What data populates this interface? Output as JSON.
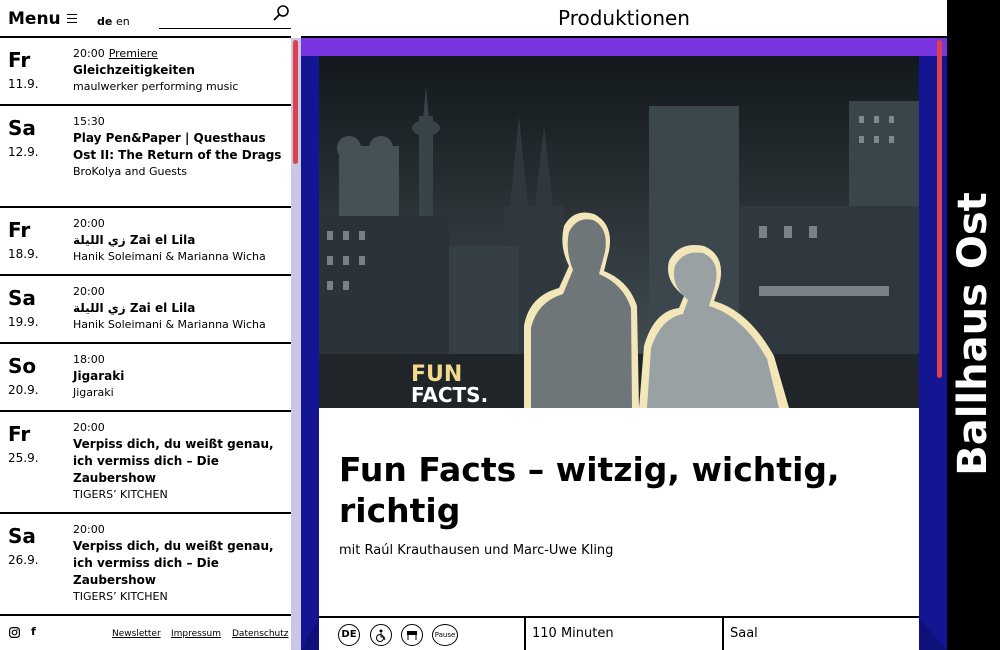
{
  "nav": {
    "menu_label": "Menu",
    "lang_de": "de",
    "lang_en": "en"
  },
  "header": {
    "title": "Produktionen"
  },
  "brand": {
    "name": "Ballhaus Ost"
  },
  "events": [
    {
      "day": "Fr",
      "date": "11.9.",
      "time": "20:00",
      "badge": "Premiere",
      "title": "Gleichzeitigkeiten",
      "subtitle": "maulwerker performing music"
    },
    {
      "day": "Sa",
      "date": "12.9.",
      "time": "15:30",
      "badge": "",
      "title": "Play Pen&Paper | Questhaus Ost II: The Return of the Drags",
      "subtitle": "BroKolya and Guests"
    },
    {
      "day": "Fr",
      "date": "18.9.",
      "time": "20:00",
      "badge": "",
      "title": "زي الليلة Zai el Lila",
      "subtitle": "Hanik Soleimani & Marianna Wicha"
    },
    {
      "day": "Sa",
      "date": "19.9.",
      "time": "20:00",
      "badge": "",
      "title": "زي الليلة Zai el Lila",
      "subtitle": "Hanik Soleimani & Marianna Wicha"
    },
    {
      "day": "So",
      "date": "20.9.",
      "time": "18:00",
      "badge": "",
      "title": "Jigaraki",
      "subtitle": "Jigaraki"
    },
    {
      "day": "Fr",
      "date": "25.9.",
      "time": "20:00",
      "badge": "",
      "title": "Verpiss dich, du weißt genau, ich vermiss dich – Die Zaubershow",
      "subtitle": "TIGERS’ KITCHEN"
    },
    {
      "day": "Sa",
      "date": "26.9.",
      "time": "20:00",
      "badge": "",
      "title": "Verpiss dich, du weißt genau, ich vermiss dich – Die Zaubershow",
      "subtitle": "TIGERS’ KITCHEN"
    }
  ],
  "footer": {
    "facebook_glyph": "f",
    "newsletter": "Newsletter",
    "impressum": "Impressum",
    "datenschutz": "Datenschutz"
  },
  "production": {
    "image_text_line1": "FUN",
    "image_text_line2": "FACTS.",
    "title": "Fun Facts – witzig, wichtig, richtig",
    "subtitle": "mit Raúl Krauthausen und Marc-Uwe Kling",
    "language_badge": "DE",
    "pause_badge": "Pause",
    "duration": "110 Minuten",
    "venue": "Saal"
  }
}
